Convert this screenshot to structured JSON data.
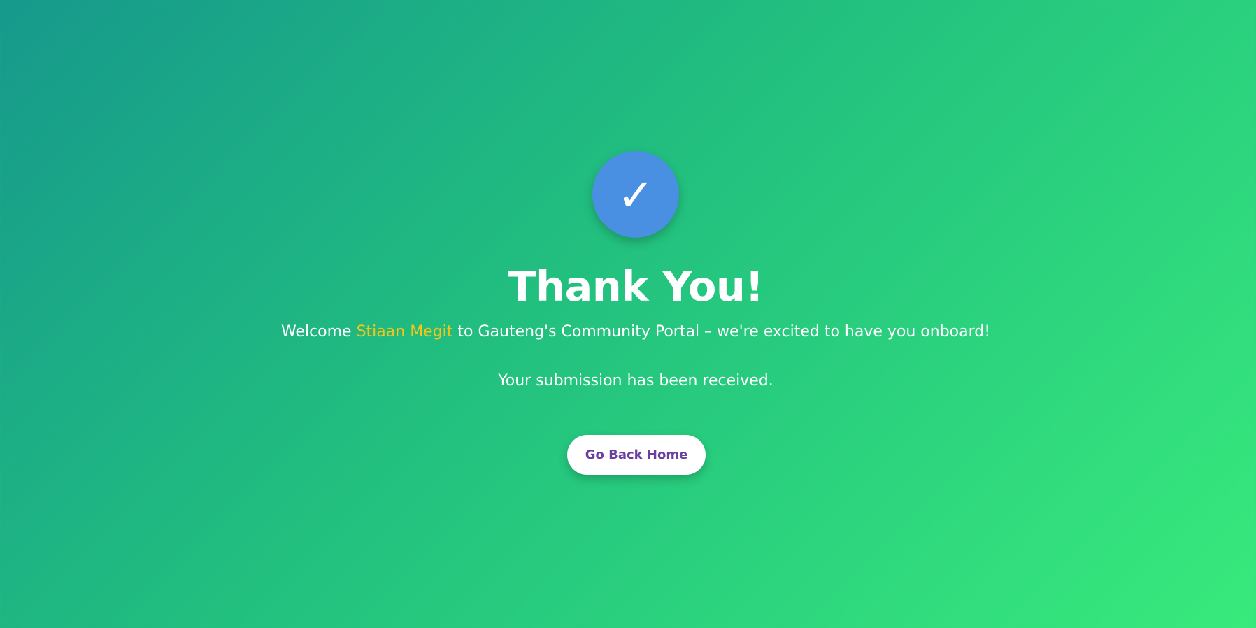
{
  "confirmation": {
    "icon": "check-icon",
    "icon_glyph": "✓",
    "icon_color": "#4a90e2",
    "title": "Thank You!",
    "welcome_prefix": "Welcome ",
    "user_name": "Stiaan Megit",
    "welcome_suffix": " to Gauteng's Community Portal – we're excited to have you onboard!",
    "received_message": "Your submission has been received.",
    "home_button_label": "Go Back Home"
  },
  "colors": {
    "background_start": "#16998c",
    "background_end": "#38ea7c",
    "highlight": "#f5c518",
    "button_text": "#6a3fa0"
  }
}
